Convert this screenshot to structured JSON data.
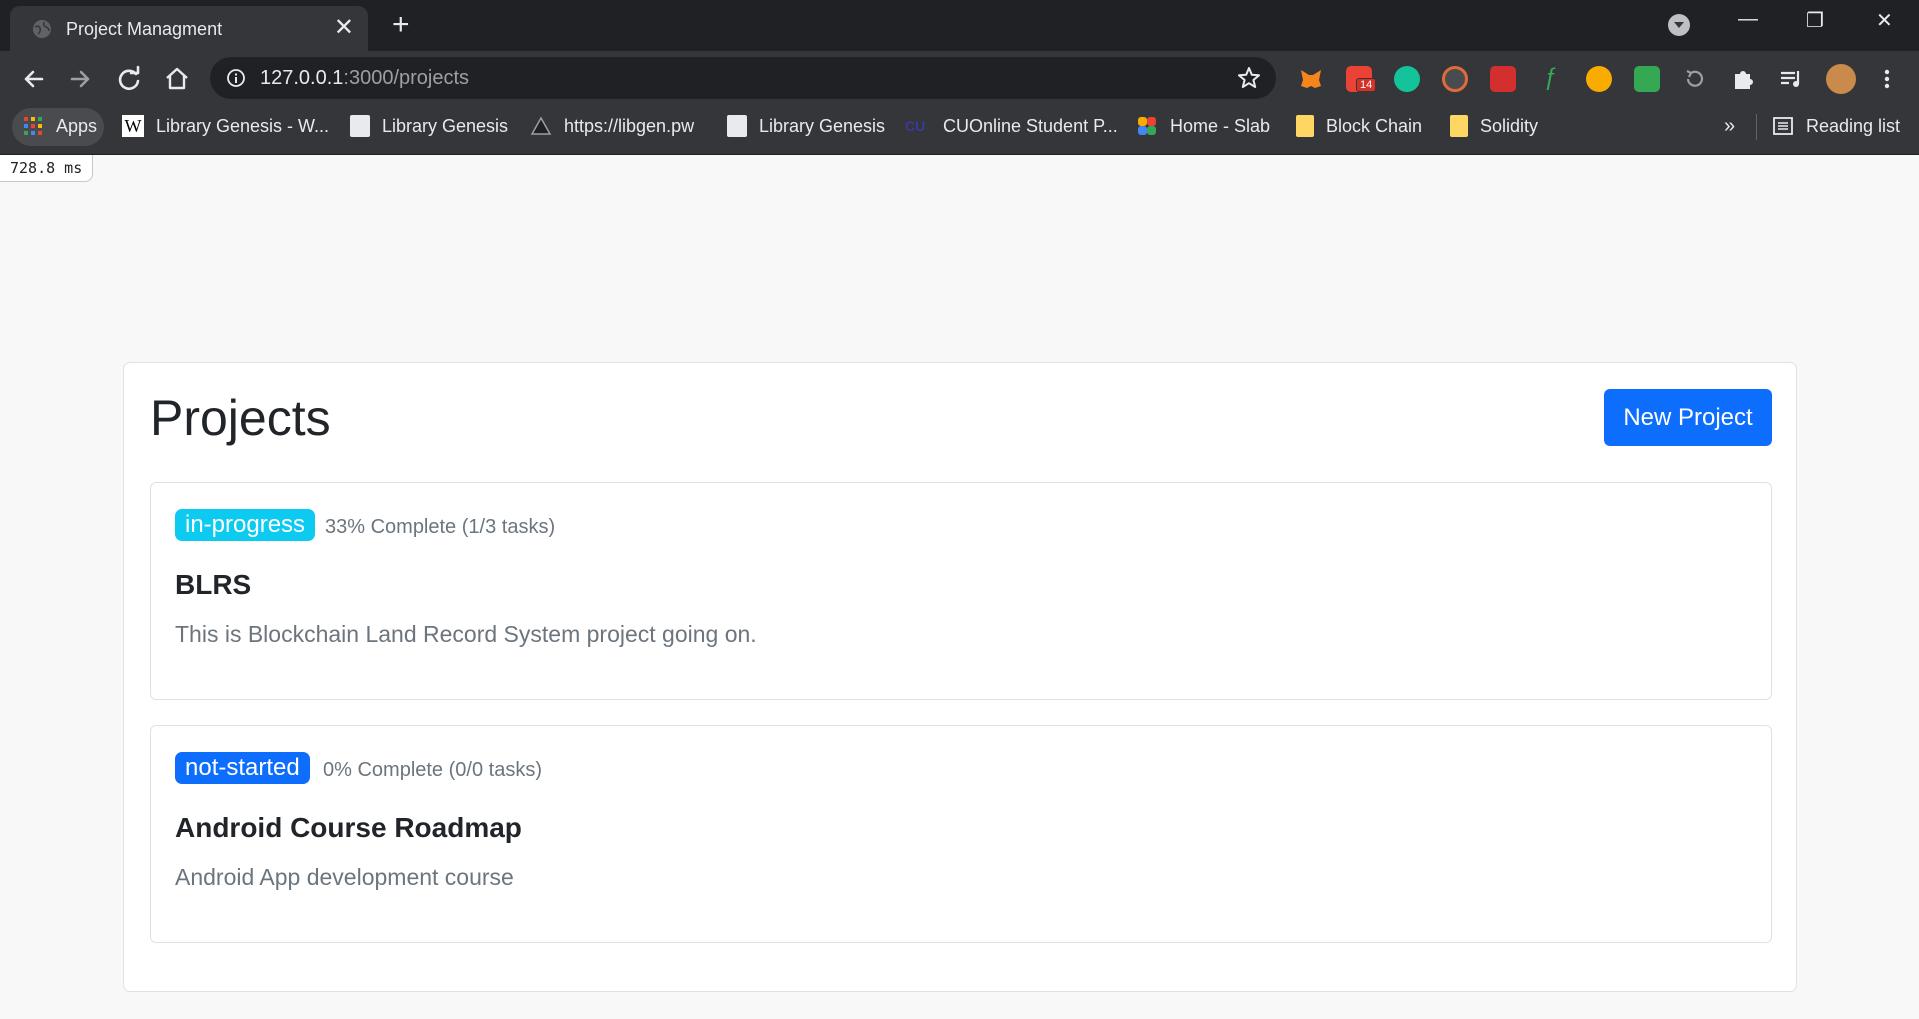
{
  "browser": {
    "tab_title": "Project Managment",
    "close_glyph": "✕",
    "new_tab_glyph": "+",
    "window": {
      "minimize": "—",
      "restore": "❐",
      "close": "✕"
    },
    "url_host": "127.0.0.1",
    "url_path": ":3000/projects",
    "extension_badge": "14",
    "bookmarks": [
      {
        "label": "Apps",
        "icon": "apps-grid-icon"
      },
      {
        "label": "Library Genesis - W...",
        "icon": "wikipedia-icon"
      },
      {
        "label": "Library Genesis",
        "icon": "libgen-icon"
      },
      {
        "label": "https://libgen.pw",
        "icon": "libgen-pw-icon"
      },
      {
        "label": "Library Genesis",
        "icon": "libgen-icon"
      },
      {
        "label": "CUOnline Student P...",
        "icon": "cuonline-icon"
      },
      {
        "label": "Home - Slab",
        "icon": "slab-icon"
      },
      {
        "label": "Block Chain",
        "icon": "folder-icon"
      },
      {
        "label": "Solidity",
        "icon": "folder-icon"
      }
    ],
    "overflow": "»",
    "reading_list": "Reading list"
  },
  "perf_timer": "728.8 ms",
  "page": {
    "heading": "Projects",
    "new_project_button": "New Project",
    "projects": [
      {
        "status": "in-progress",
        "status_color": "#0dcaf0",
        "progress_text": "33% Complete (1/3 tasks)",
        "title": "BLRS",
        "description": "This is Blockchain Land Record System project going on."
      },
      {
        "status": "not-started",
        "status_color": "#0d6efd",
        "progress_text": "0% Complete (0/0 tasks)",
        "title": "Android Course Roadmap",
        "description": "Android App development course"
      }
    ]
  },
  "colors": {
    "accent": "#0d6efd",
    "info": "#0dcaf0",
    "chrome_dark": "#202124",
    "chrome_toolbar": "#35363a"
  }
}
